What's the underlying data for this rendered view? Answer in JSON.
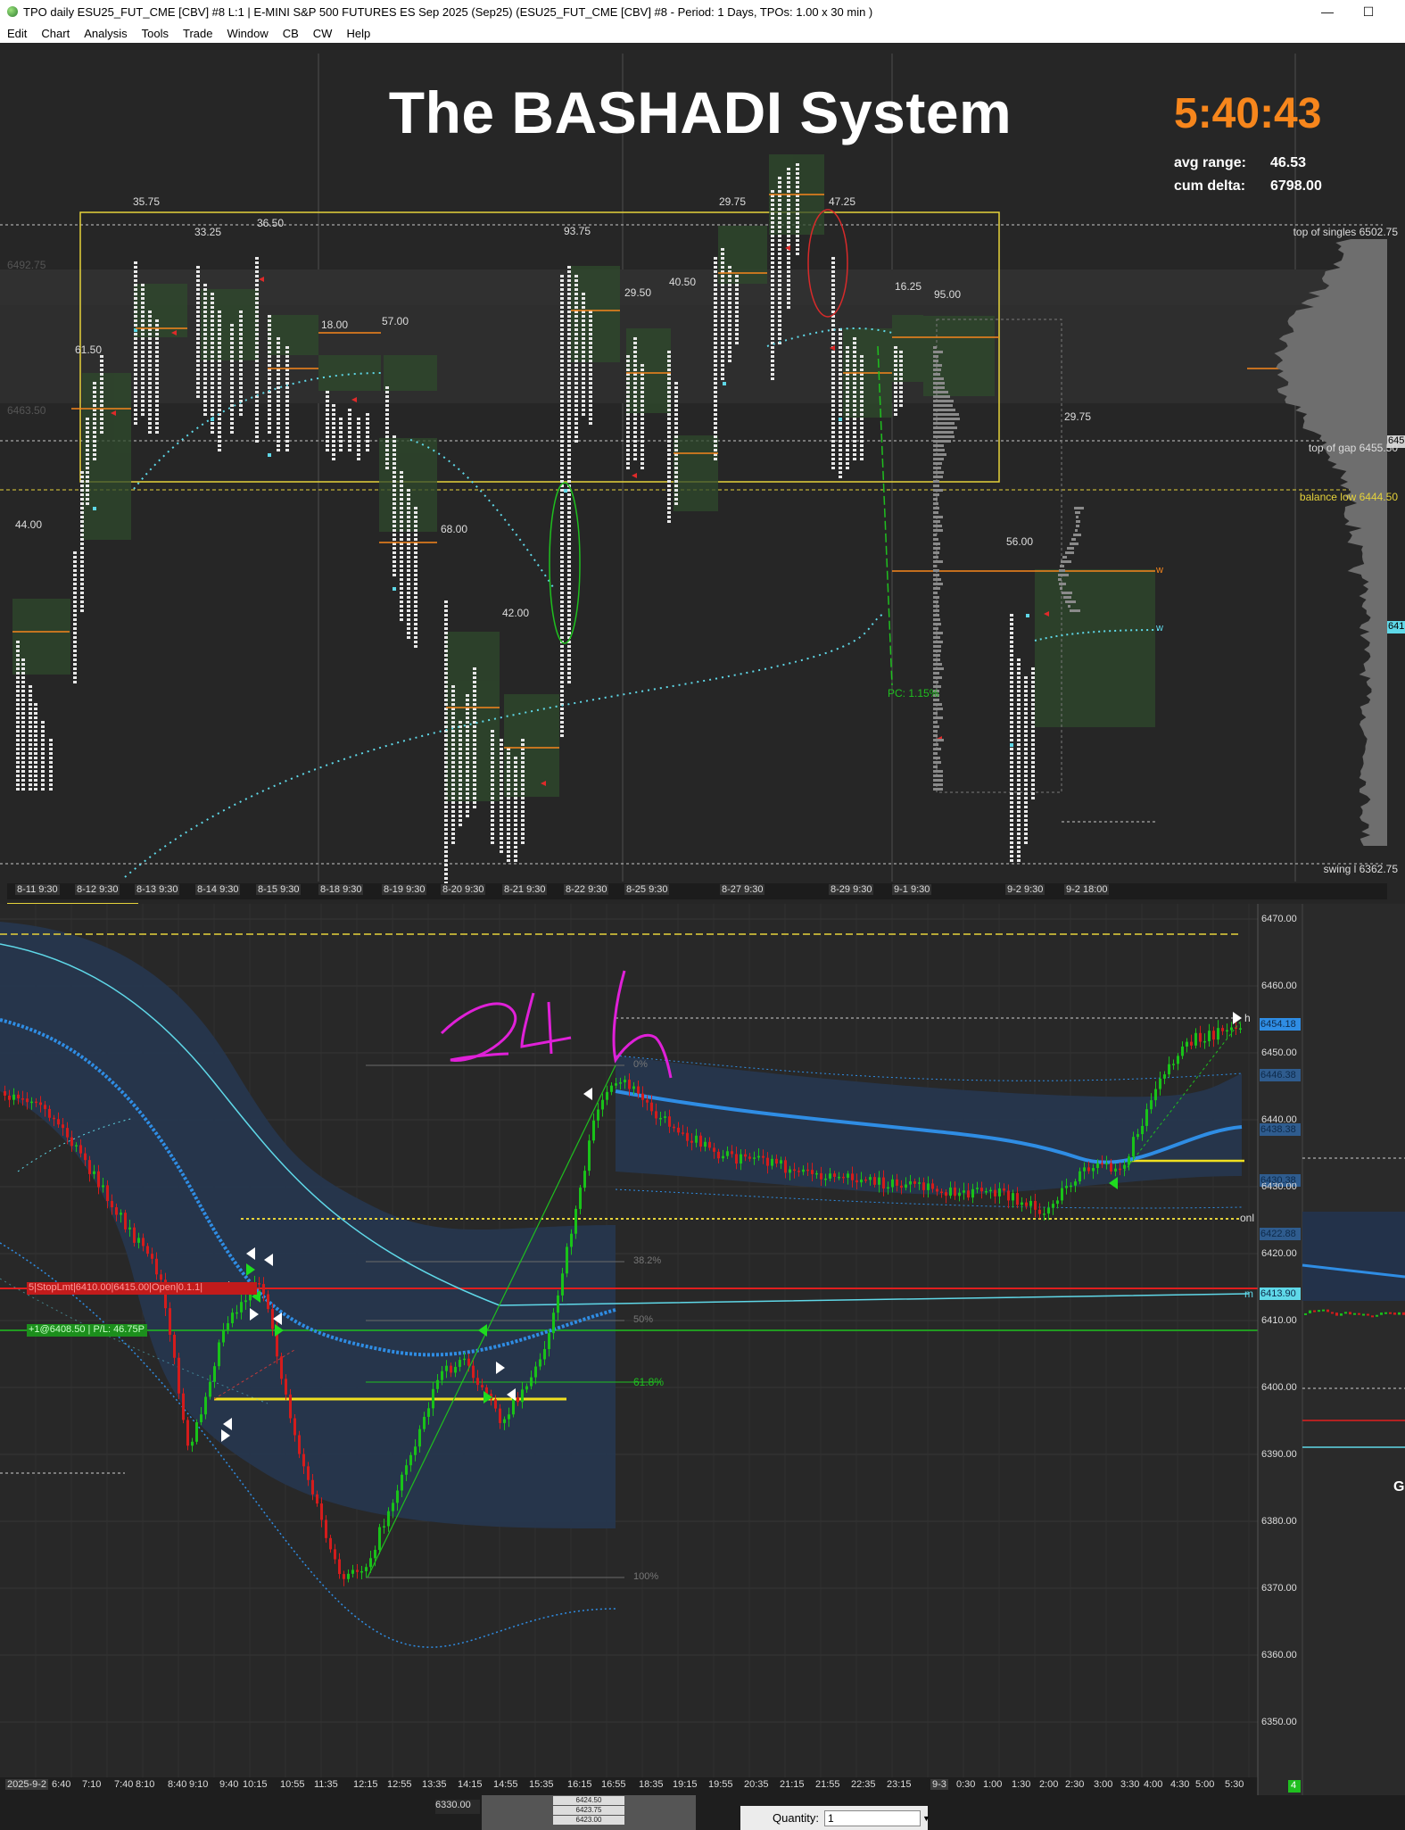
{
  "window": {
    "title": "TPO daily ESU25_FUT_CME [CBV] #8 L:1 | E-MINI S&P 500 FUTURES ES Sep 2025 (Sep25) (ESU25_FUT_CME [CBV] #8 - Period: 1 Days, TPOs: 1.00 x 30 min  )",
    "minimize_glyph": "—",
    "maximize_glyph": "☐"
  },
  "menu": [
    "Edit",
    "Chart",
    "Analysis",
    "Tools",
    "Trade",
    "Window",
    "CB",
    "CW",
    "Help"
  ],
  "tpo": {
    "title": "The BASHADI System",
    "timer": "5:40:43",
    "avg_range_label": "avg range:",
    "avg_range_value": "46.53",
    "cum_delta_label": "cum delta:",
    "cum_delta_value": "6798.00",
    "right_labels": {
      "top_of_singles": "top of singles  6502.75",
      "top_of_gap": "top of gap  6455.50",
      "balance_low": "balance low  6444.50",
      "swing_l": "swing l  6362.75"
    },
    "left_prices": [
      "6492.75",
      "6463.50"
    ],
    "edge_prices": [
      "645",
      "641"
    ],
    "pc_label": "PC: 1.15%",
    "range_labels": [
      "44.00",
      "61.50",
      "35.75",
      "33.25",
      "36.50",
      "18.00",
      "57.00",
      "68.00",
      "42.00",
      "93.75",
      "29.50",
      "40.50",
      "29.75",
      "47.25",
      "16.25",
      "95.00",
      "56.00",
      "29.75"
    ],
    "dates": [
      "8-11  9:30",
      "8-12  9:30",
      "8-13  9:30",
      "8-14  9:30",
      "8-15  9:30",
      "8-18  9:30",
      "8-19  9:30",
      "8-20  9:30",
      "8-21  9:30",
      "8-22  9:30",
      "8-25  9:30",
      "8-27  9:30",
      "8-29  9:30",
      "9-1  9:30",
      "9-2  9:30",
      "9-2  18:00"
    ],
    "marker_w": "w"
  },
  "intraday": {
    "y_ticks": [
      "6470.00",
      "6460.00",
      "6450.00",
      "6440.00",
      "6430.00",
      "6420.00",
      "6410.00",
      "6400.00",
      "6390.00",
      "6380.00",
      "6370.00",
      "6360.00",
      "6350.00"
    ],
    "x_ticks": [
      "2025-9-2",
      "6:40",
      "7:10",
      "7:40",
      "8:10",
      "8:40",
      "9:10",
      "9:40",
      "10:15",
      "10:55",
      "11:35",
      "12:15",
      "12:55",
      "13:35",
      "14:15",
      "14:55",
      "15:35",
      "16:15",
      "16:55",
      "18:35",
      "19:15",
      "19:55",
      "20:35",
      "21:15",
      "21:55",
      "22:35",
      "23:15",
      "9-3",
      "0:30",
      "1:00",
      "1:30",
      "2:00",
      "2:30",
      "3:00",
      "3:30",
      "4:00",
      "4:30",
      "5:00",
      "5:30"
    ],
    "price_tags": [
      "6454.18",
      "6446.38",
      "6438.38",
      "6430.38",
      "6422.88",
      "6413.90"
    ],
    "fib_labels": [
      "0%",
      "38.2%",
      "50%",
      "61.8%",
      "100%"
    ],
    "stop_order_label": "5|StopLmt|6410.00|6415.00|Open|0.1.1|",
    "position_label": "+1@6408.50 | P/L: 46.75P",
    "onl_label": "onl",
    "m_label": "m",
    "h_label": "h",
    "handwritten": "241",
    "g_label": "G",
    "badge_count": "4"
  },
  "bottom": {
    "price_field": "6330.00",
    "ladder_prices": [
      "6424.50",
      "6423.75",
      "6423.00"
    ],
    "quantity_label": "Quantity:",
    "quantity_value": "1"
  },
  "colors": {
    "orange": "#f7861c",
    "yellow": "#e5d23a",
    "cyan": "#5fd8e8",
    "blue": "#2f8de4",
    "green_candle": "#19c219",
    "red_candle": "#d41c1c",
    "magenta": "#e020d8"
  }
}
